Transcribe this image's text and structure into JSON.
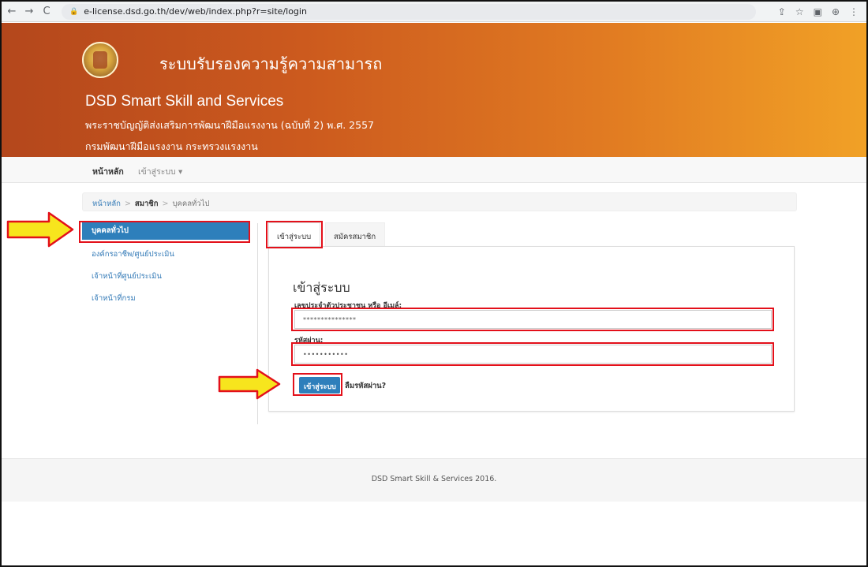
{
  "browser": {
    "url": "e-license.dsd.go.th/dev/web/index.php?r=site/login",
    "back": "←",
    "forward": "→",
    "reload": "C",
    "lock": "🔒",
    "toolbar_icons": [
      "⇪",
      "☆",
      "▣",
      "⊕",
      "⋮"
    ]
  },
  "header": {
    "title_th": "ระบบรับรองความรู้ความสามารถ",
    "title_en": "DSD Smart Skill and Services",
    "subtitle": "พระราชบัญญัติส่งเสริมการพัฒนาฝีมือแรงงาน (ฉบับที่ 2) พ.ศ. 2557",
    "department": "กรมพัฒนาฝีมือแรงงาน กระทรวงแรงงาน"
  },
  "topnav": {
    "home": "หน้าหลัก",
    "login": "เข้าสู่ระบบ ▾"
  },
  "breadcrumb": {
    "home": "หน้าหลัก",
    "member": "สมาชิก",
    "current": "บุคคลทั่วไป",
    "sep": ">"
  },
  "sidebar": {
    "items": [
      {
        "label": "บุคคลทั่วไป"
      },
      {
        "label": "องค์กรอาชีพ/ศูนย์ประเมิน"
      },
      {
        "label": "เจ้าหน้าที่ศูนย์ประเมิน"
      },
      {
        "label": "เจ้าหน้าที่กรม"
      }
    ]
  },
  "tabs": {
    "login": "เข้าสู่ระบบ",
    "register": "สมัครสมาชิก"
  },
  "form": {
    "heading": "เข้าสู่ระบบ",
    "id_label": "เลขประจำตัวประชาชน หรือ อีเมล์:",
    "id_value": "***************",
    "password_label": "รหัสผ่าน:",
    "password_value": "•••••••••••",
    "submit": "เข้าสู่ระบบ",
    "forgot": "ลืมรหัสผ่าน?"
  },
  "footer": {
    "text": "DSD Smart Skill & Services 2016."
  },
  "colors": {
    "accent": "#2e7fbb",
    "highlight": "#e3101a",
    "arrow_fill": "#f7e51d"
  }
}
